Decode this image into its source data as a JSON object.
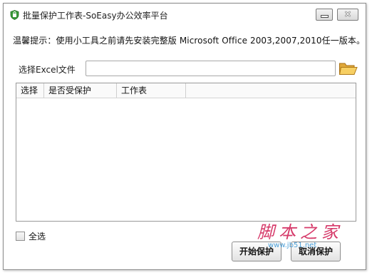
{
  "window": {
    "title": "批量保护工作表-SoEasy办公效率平台",
    "minimize_symbol": "_",
    "close_symbol": "✕"
  },
  "tip": "温馨提示：使用小工具之前请先安装完整版 Microsoft Office 2003,2007,2010任一版本。",
  "file": {
    "label": "选择Excel文件",
    "value": "",
    "placeholder": "",
    "browse_icon": "folder-open-icon"
  },
  "table": {
    "columns": [
      "选择",
      "是否受保护",
      "工作表"
    ],
    "rows": []
  },
  "select_all": {
    "label": "全选",
    "checked": false
  },
  "buttons": {
    "start": "开始保护",
    "cancel": "取消保护"
  },
  "watermark": {
    "text": "脚本之家",
    "url": "www.jb51.net"
  },
  "colors": {
    "watermark": "#d63a6a",
    "watermark_url": "#4da0d8",
    "app_icon": "#3a9a3a"
  }
}
